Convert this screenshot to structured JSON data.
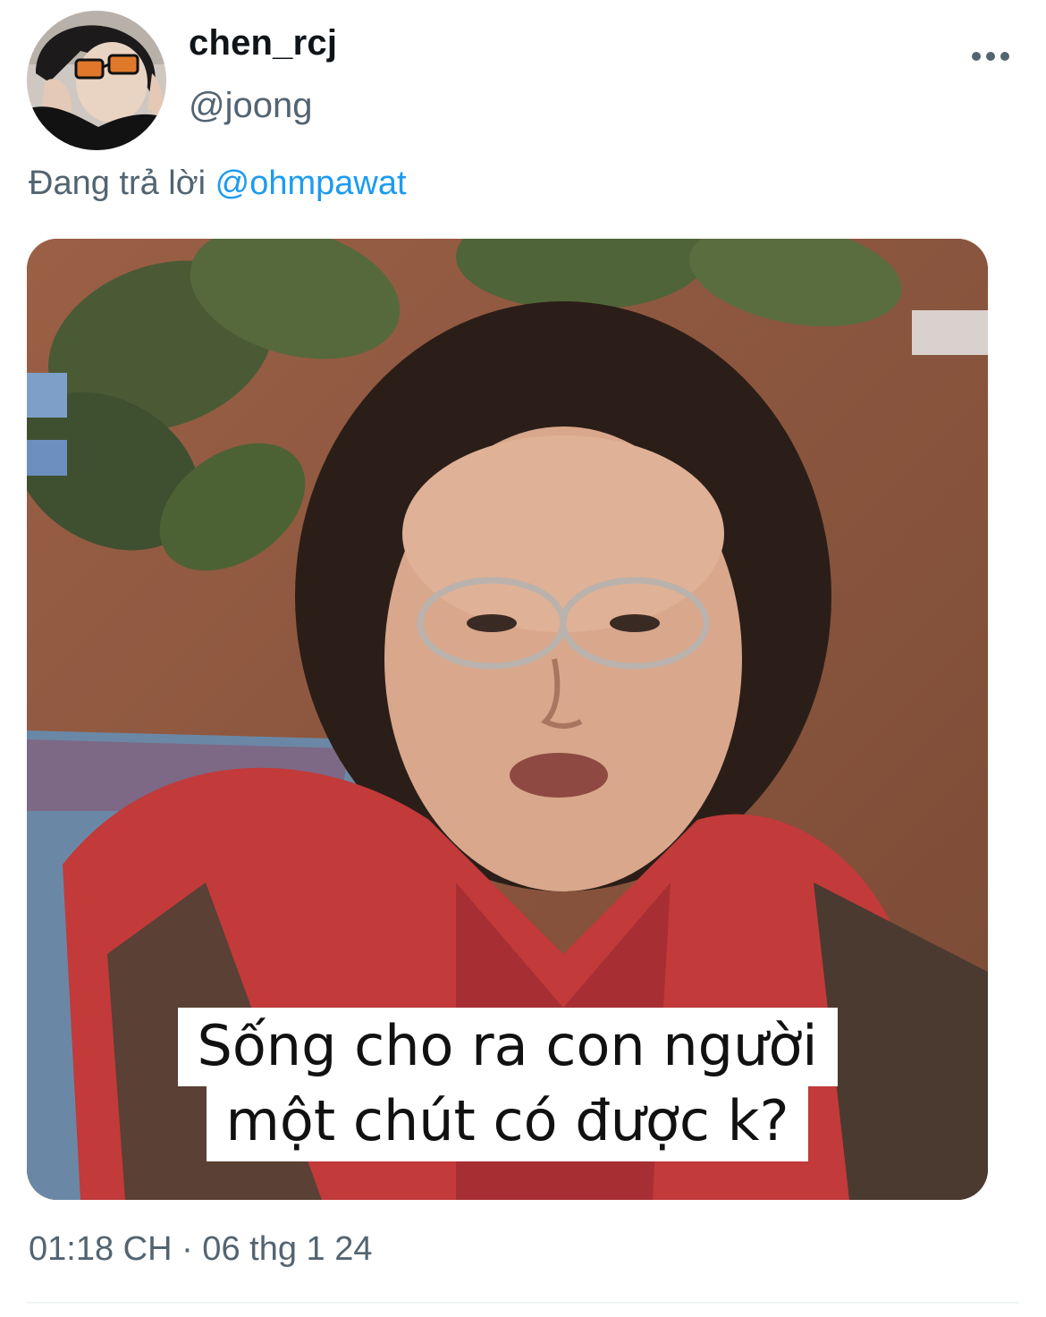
{
  "tweet": {
    "author": {
      "display_name": "chen_rcj",
      "handle": "@joong"
    },
    "more_icon": "more-horizontal-icon",
    "reply": {
      "prefix": "Đang trả lời ",
      "mention": "@ohmpawat"
    },
    "media": {
      "caption_line_1": "Sống cho ra con người",
      "caption_line_2": "một chút có được k?"
    },
    "timestamp": "01:18 CH · 06 thg 1 24"
  },
  "colors": {
    "text_primary": "#0f1419",
    "text_secondary": "#536471",
    "link": "#1d9bf0",
    "divider": "#eff3f4"
  }
}
